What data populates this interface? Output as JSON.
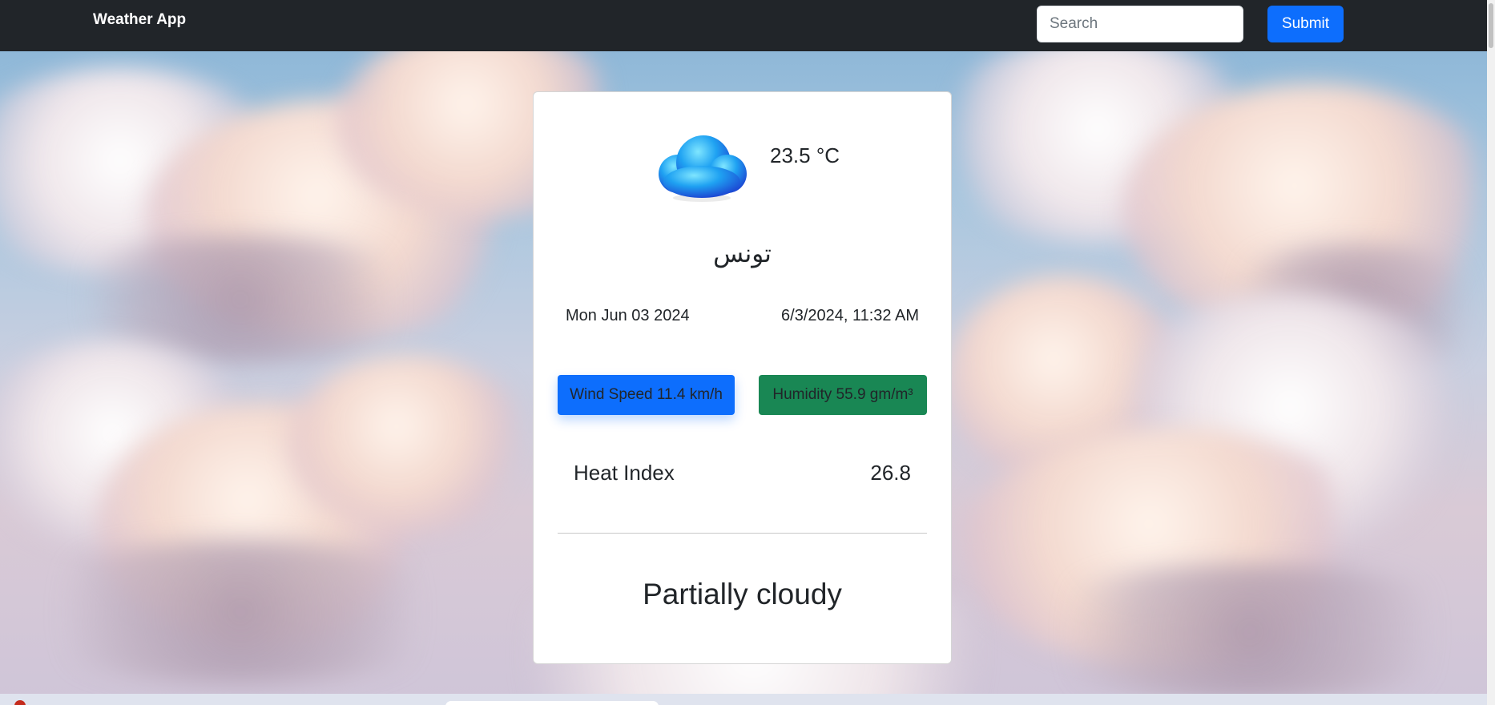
{
  "navbar": {
    "brand": "Weather App",
    "search_placeholder": "Search",
    "search_value": "",
    "submit_label": "Submit"
  },
  "weather": {
    "icon": "cloud-icon",
    "temperature": "23.5 °C",
    "city": "تونس",
    "date": "Mon Jun 03 2024",
    "datetime": "6/3/2024, 11:32 AM",
    "wind_speed": "Wind Speed 11.4 km/h",
    "humidity": "Humidity 55.9 gm/m³",
    "heat_index_label": "Heat Index",
    "heat_index_value": "26.8",
    "condition": "Partially cloudy"
  },
  "colors": {
    "navbar_bg": "#212529",
    "primary": "#0d6efd",
    "success": "#198754",
    "card_bg": "#ffffff"
  }
}
